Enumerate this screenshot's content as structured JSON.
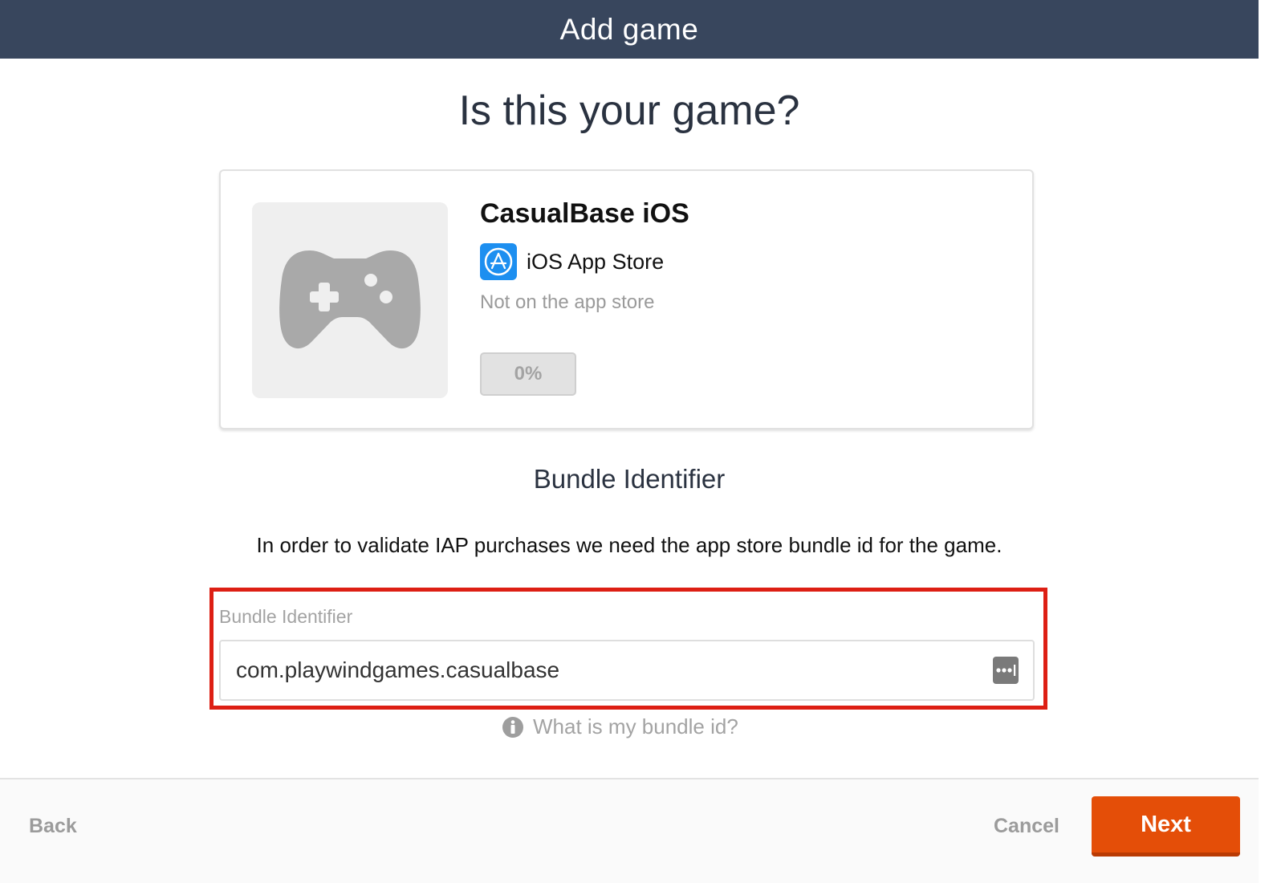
{
  "header": {
    "title": "Add game"
  },
  "page": {
    "title": "Is this your game?"
  },
  "game": {
    "name": "CasualBase iOS",
    "store": "iOS App Store",
    "store_status": "Not on the app store",
    "progress_label": "0%",
    "thumbnail_icon": "gamepad-icon",
    "store_icon": "app-store-icon"
  },
  "bundle": {
    "section_title": "Bundle Identifier",
    "description": "In order to validate IAP purchases we need the app store bundle id for the game.",
    "field_label": "Bundle Identifier",
    "field_value": "com.playwindgames.casualbase",
    "field_icon": "password-manager-icon",
    "help_text": "What is my bundle id?",
    "help_icon": "info-icon"
  },
  "footer": {
    "back_label": "Back",
    "cancel_label": "Cancel",
    "next_label": "Next"
  },
  "colors": {
    "header_bg": "#38465d",
    "accent": "#e44e08",
    "highlight": "#dd1f14",
    "store_blue": "#1d8ff0"
  }
}
